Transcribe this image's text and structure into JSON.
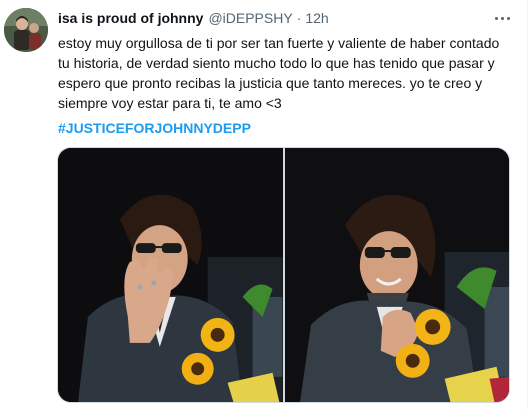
{
  "tweet": {
    "author_name": "isa is proud of johnny",
    "handle": "@iDEPPSHY",
    "separator": "·",
    "timestamp": "12h",
    "text": "estoy muy orgullosa de ti por ser tan fuerte y valiente de haber contado tu historia, de verdad siento mucho todo lo que has tenido que pasar y espero que pronto recibas la justicia que tanto mereces. yo te creo y siempre voy estar para ti, te amo <3",
    "hashtag": "#JUSTICEFORJOHNNYDEPP",
    "media_count": 2
  },
  "icons": {
    "more": "more-options-icon",
    "avatar": "avatar"
  },
  "colors": {
    "link": "#1d9bf0",
    "secondary_text": "#536471",
    "primary_text": "#0f1419"
  }
}
